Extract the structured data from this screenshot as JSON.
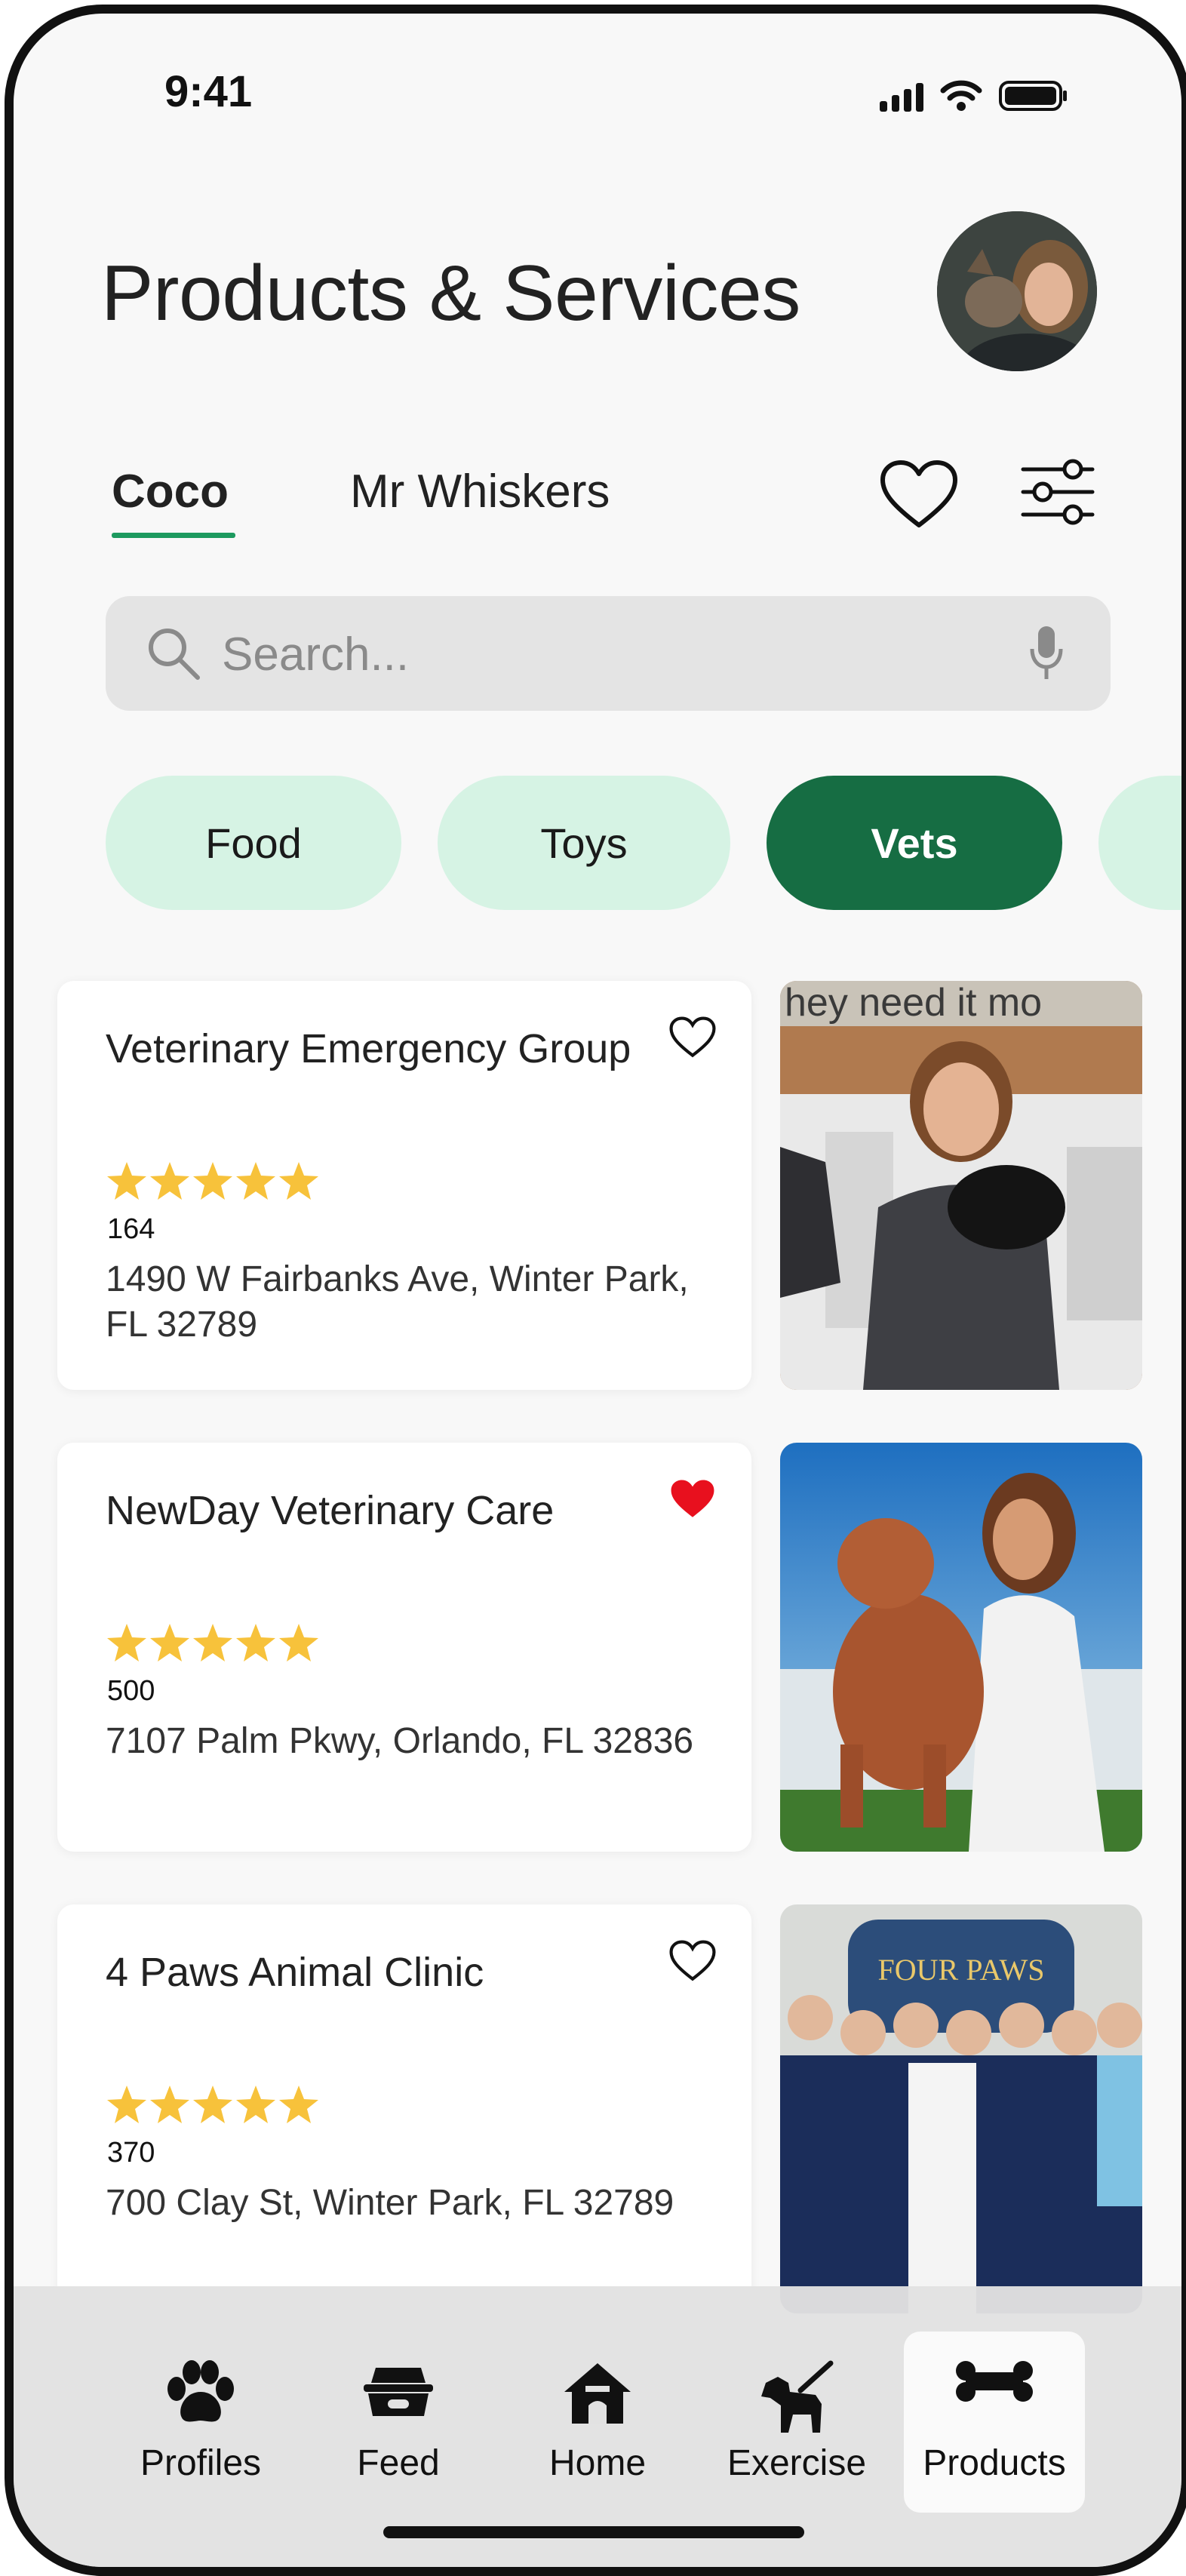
{
  "status_bar": {
    "time": "9:41"
  },
  "header": {
    "title": "Products & Services"
  },
  "pet_tabs": [
    {
      "label": "Coco",
      "active": true
    },
    {
      "label": "Mr Whiskers",
      "active": false
    }
  ],
  "search": {
    "placeholder": "Search..."
  },
  "categories": [
    {
      "label": "Food",
      "active": false
    },
    {
      "label": "Toys",
      "active": false
    },
    {
      "label": "Vets",
      "active": true
    }
  ],
  "listings": [
    {
      "name": "Veterinary Emergency Group",
      "rating": 5,
      "reviews": "164",
      "address": "1490 W Fairbanks Ave, Winter Park, FL 32789",
      "favorited": false,
      "photo_banner": "hey need it mo"
    },
    {
      "name": "NewDay Veterinary Care",
      "rating": 5,
      "reviews": "500",
      "address": "7107 Palm Pkwy, Orlando, FL 32836",
      "favorited": true
    },
    {
      "name": "4 Paws Animal Clinic",
      "rating": 5,
      "reviews": "370",
      "address": "700 Clay St, Winter Park, FL 32789",
      "favorited": false,
      "photo_sign": "FOUR PAWS"
    }
  ],
  "bottom_nav": [
    {
      "label": "Profiles",
      "icon": "paw-icon"
    },
    {
      "label": "Feed",
      "icon": "food-bowl-icon"
    },
    {
      "label": "Home",
      "icon": "house-icon"
    },
    {
      "label": "Exercise",
      "icon": "dog-leash-icon"
    },
    {
      "label": "Products",
      "icon": "bone-icon",
      "active": true
    }
  ],
  "colors": {
    "accent_green": "#166d43",
    "chip_green": "#d6f3e4",
    "underline_green": "#1d9a5f",
    "star_yellow": "#f7c23b",
    "heart_red": "#e8101e"
  }
}
